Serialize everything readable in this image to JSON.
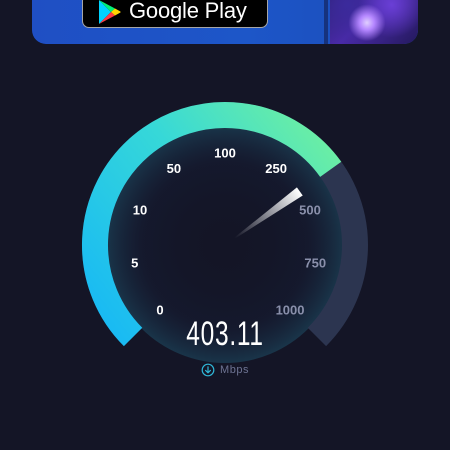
{
  "ad": {
    "store_badge_label": "Google Play",
    "store_badge_icon": "google-play-icon"
  },
  "gauge": {
    "speed": "403.11",
    "speed_value": 403.11,
    "unit": "Mbps",
    "unit_icon": "download-arrow-icon",
    "scale_labels": [
      "0",
      "5",
      "10",
      "50",
      "100",
      "250",
      "500",
      "750",
      "1000"
    ],
    "scale_values": [
      0,
      5,
      10,
      50,
      100,
      250,
      500,
      750,
      1000
    ],
    "colors": {
      "background": "#141526",
      "arc_start": "#17b8f5",
      "arc_end": "#6ff0a0",
      "arc_track": "#2c3550",
      "needle": "#ffffff",
      "active_label": "#ffffff",
      "inactive_label": "#8a90ab"
    }
  }
}
